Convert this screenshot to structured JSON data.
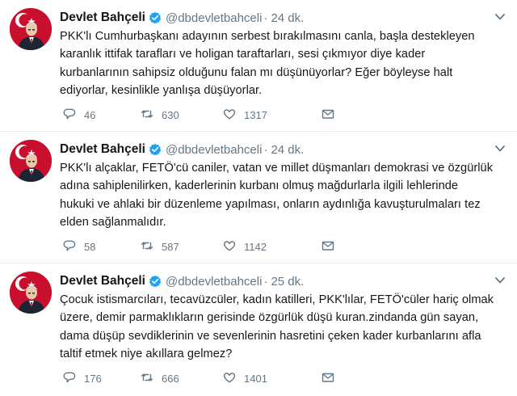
{
  "tweets": [
    {
      "name": "Devlet Bahçeli",
      "handle": "@dbdevletbahceli",
      "time": "24 dk.",
      "text_lines": [
        "PKK'lı Cumhurbaşkanı adayının serbest bırakılmasını canla, başla destekleyen",
        "karanlık ittifak tarafları ve holigan taraftarları, sesi çıkmıyor diye kader",
        "kurbanlarının sahipsiz olduğunu falan mı düşünüyorlar? Eğer böyleyse halt",
        "ediyorlar, kesinlikle yanlışa düşüyorlar."
      ],
      "replies": "46",
      "retweets": "630",
      "likes": "1317"
    },
    {
      "name": "Devlet Bahçeli",
      "handle": "@dbdevletbahceli",
      "time": "24 dk.",
      "text_lines": [
        "PKK'lı alçaklar, FETÖ'cü caniler, vatan ve millet düşmanları demokrasi ve özgürlük",
        "adına sahiplenilirken, kaderlerinin kurbanı olmuş mağdurlarla ilgili lehlerinde",
        "hukuki ve ahlaki bir düzenleme yapılması, onların aydınlığa kavuşturulmaları tez",
        "elden sağlanmalıdır."
      ],
      "replies": "58",
      "retweets": "587",
      "likes": "1142"
    },
    {
      "name": "Devlet Bahçeli",
      "handle": "@dbdevletbahceli",
      "time": "25 dk.",
      "text_lines": [
        "Çocuk istismarcıları, tecavüzcüler, kadın katilleri, PKK'lılar, FETÖ'cüler hariç olmak",
        "üzere, demir parmaklıkların gerisinde özgürlük düşü kuran.zindanda gün sayan,",
        "dama düşüp sevdiklerinin ve sevenlerinin hasretini çeken kader kurbanlarını afla",
        "taltif etmek niye akıllara gelmez?"
      ],
      "replies": "176",
      "retweets": "666",
      "likes": "1401"
    }
  ],
  "icons": {
    "verified": "verified-badge-icon",
    "caret": "chevron-down-icon",
    "reply": "reply-icon",
    "retweet": "retweet-icon",
    "like": "heart-icon",
    "dm": "envelope-icon"
  },
  "colors": {
    "text": "#14171a",
    "secondary": "#657786",
    "verified": "#1da1f2",
    "avatar_bg": "#c8102e"
  }
}
